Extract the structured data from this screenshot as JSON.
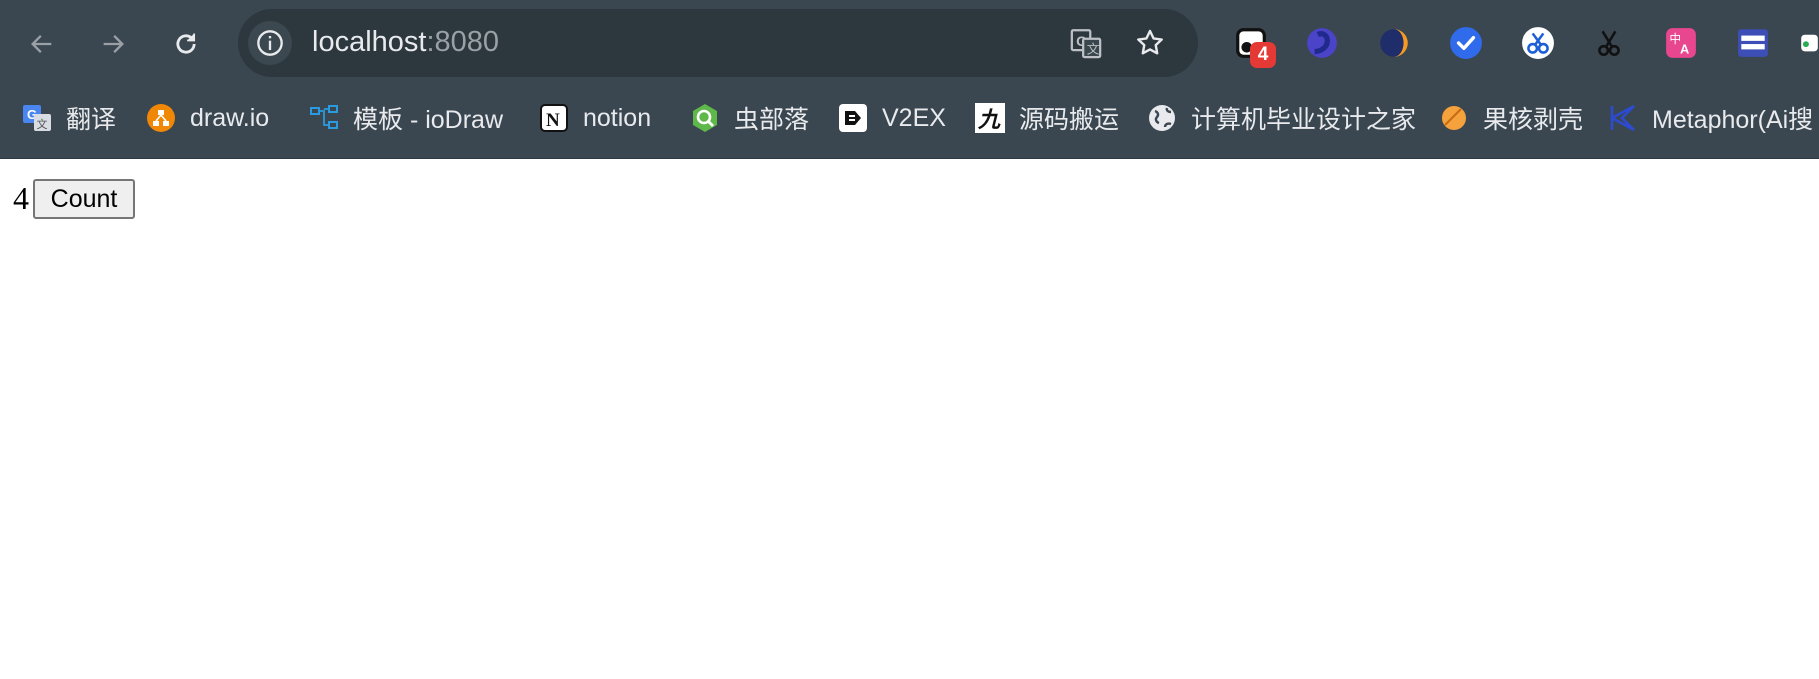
{
  "browser": {
    "url_host": "localhost",
    "url_port": ":8080",
    "extension_badge": "4"
  },
  "bookmarks": [
    {
      "label": "翻译",
      "icon": "google-translate-icon"
    },
    {
      "label": "draw.io",
      "icon": "drawio-icon"
    },
    {
      "label": "模板 - ioDraw",
      "icon": "iodraw-icon"
    },
    {
      "label": "notion",
      "icon": "notion-icon"
    },
    {
      "label": "虫部落",
      "icon": "chongbuluo-icon"
    },
    {
      "label": "V2EX",
      "icon": "v2ex-icon"
    },
    {
      "label": "源码搬运",
      "icon": "yuanma-icon"
    },
    {
      "label": "计算机毕业设计之家",
      "icon": "globe-icon"
    },
    {
      "label": "果核剥壳",
      "icon": "guohe-icon"
    },
    {
      "label": "Metaphor(Ai搜",
      "icon": "metaphor-icon"
    }
  ],
  "page": {
    "count_value": "4",
    "count_button_label": "Count"
  },
  "colors": {
    "chrome_bg": "#3a4750",
    "omnibox_bg": "#2c373e",
    "badge_red": "#e53935"
  }
}
